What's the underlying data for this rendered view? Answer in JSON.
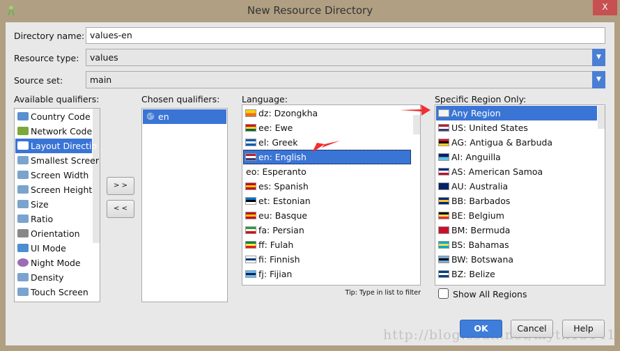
{
  "window": {
    "title": "New Resource Directory",
    "close_label": "X"
  },
  "form": {
    "directory_name_label": "Directory name:",
    "directory_name_value": "values-en",
    "resource_type_label": "Resource type:",
    "resource_type_value": "values",
    "source_set_label": "Source set:",
    "source_set_value": "main"
  },
  "available": {
    "label": "Available qualifiers:",
    "items": [
      {
        "label": "Country Code",
        "icon": "country-code-icon"
      },
      {
        "label": "Network Code",
        "icon": "network-code-icon"
      },
      {
        "label": "Layout Directio",
        "icon": "layout-direction-icon",
        "selected": true
      },
      {
        "label": "Smallest Screer",
        "icon": "smallest-screen-icon"
      },
      {
        "label": "Screen Width",
        "icon": "screen-width-icon"
      },
      {
        "label": "Screen Height",
        "icon": "screen-height-icon"
      },
      {
        "label": "Size",
        "icon": "size-icon"
      },
      {
        "label": "Ratio",
        "icon": "ratio-icon"
      },
      {
        "label": "Orientation",
        "icon": "orientation-icon"
      },
      {
        "label": "UI Mode",
        "icon": "ui-mode-icon"
      },
      {
        "label": "Night Mode",
        "icon": "night-mode-icon"
      },
      {
        "label": "Density",
        "icon": "density-icon"
      },
      {
        "label": "Touch Screen",
        "icon": "touch-screen-icon"
      }
    ]
  },
  "chosen": {
    "label": "Chosen qualifiers:",
    "items": [
      {
        "label": "en",
        "icon": "globe-icon"
      }
    ]
  },
  "move_buttons": {
    "add": "> >",
    "remove": "< <"
  },
  "language": {
    "label": "Language:",
    "tip": "Tip: Type in list to filter",
    "items": [
      {
        "label": "dz: Dzongkha",
        "colors": [
          "#f7d300",
          "#f26b1d"
        ]
      },
      {
        "label": "ee: Ewe",
        "colors": [
          "#ce1126",
          "#fcd116",
          "#006b3f"
        ]
      },
      {
        "label": "el: Greek",
        "colors": [
          "#0d5eaf",
          "#ffffff",
          "#0d5eaf"
        ]
      },
      {
        "label": "en: English",
        "colors": [
          "#b22234",
          "#ffffff",
          "#3c3b6e"
        ],
        "selected": true
      },
      {
        "label": "eo: Esperanto",
        "colors": []
      },
      {
        "label": "es: Spanish",
        "colors": [
          "#c60b1e",
          "#ffc400",
          "#c60b1e"
        ]
      },
      {
        "label": "et: Estonian",
        "colors": [
          "#0072ce",
          "#000000",
          "#ffffff"
        ]
      },
      {
        "label": "eu: Basque",
        "colors": [
          "#c60b1e",
          "#ffc400",
          "#c60b1e"
        ]
      },
      {
        "label": "fa: Persian",
        "colors": [
          "#239f40",
          "#ffffff",
          "#da0000"
        ]
      },
      {
        "label": "ff: Fulah",
        "colors": [
          "#00853f",
          "#fdef42",
          "#e31b23"
        ]
      },
      {
        "label": "fi: Finnish",
        "colors": [
          "#ffffff",
          "#003580",
          "#ffffff"
        ]
      },
      {
        "label": "fj: Fijian",
        "colors": [
          "#68bfe5",
          "#012169",
          "#68bfe5"
        ]
      }
    ]
  },
  "region": {
    "label": "Specific Region Only:",
    "show_all_label": "Show All Regions",
    "show_all_checked": false,
    "items": [
      {
        "label": "Any Region",
        "colors": [
          "#f4f4f4"
        ],
        "selected": true
      },
      {
        "label": "US: United States",
        "colors": [
          "#b22234",
          "#ffffff",
          "#3c3b6e"
        ]
      },
      {
        "label": "AG: Antigua & Barbuda",
        "colors": [
          "#ce1126",
          "#000000",
          "#fcd116"
        ]
      },
      {
        "label": "AI: Anguilla",
        "colors": [
          "#012169",
          "#68bfe5"
        ]
      },
      {
        "label": "AS: American Samoa",
        "colors": [
          "#002b7f",
          "#ffffff",
          "#bf0a30"
        ]
      },
      {
        "label": "AU: Australia",
        "colors": [
          "#012169",
          "#012169"
        ]
      },
      {
        "label": "BB: Barbados",
        "colors": [
          "#00267f",
          "#ffc726",
          "#00267f"
        ]
      },
      {
        "label": "BE: Belgium",
        "colors": [
          "#000000",
          "#fae042",
          "#ed2939"
        ]
      },
      {
        "label": "BM: Bermuda",
        "colors": [
          "#c8102e",
          "#c8102e"
        ]
      },
      {
        "label": "BS: Bahamas",
        "colors": [
          "#00abc9",
          "#fae042",
          "#00abc9"
        ]
      },
      {
        "label": "BW: Botswana",
        "colors": [
          "#75aadb",
          "#000000",
          "#75aadb"
        ]
      },
      {
        "label": "BZ: Belize",
        "colors": [
          "#003f87",
          "#ffffff",
          "#003f87"
        ]
      }
    ]
  },
  "buttons": {
    "ok": "OK",
    "cancel": "Cancel",
    "help": "Help"
  },
  "watermark": "http://blog.csdn.net/myth13141314",
  "colors": {
    "accent": "#3a75d6",
    "title_bar": "#b09f83",
    "close": "#c75050",
    "annotation_arrow": "#f03030"
  }
}
